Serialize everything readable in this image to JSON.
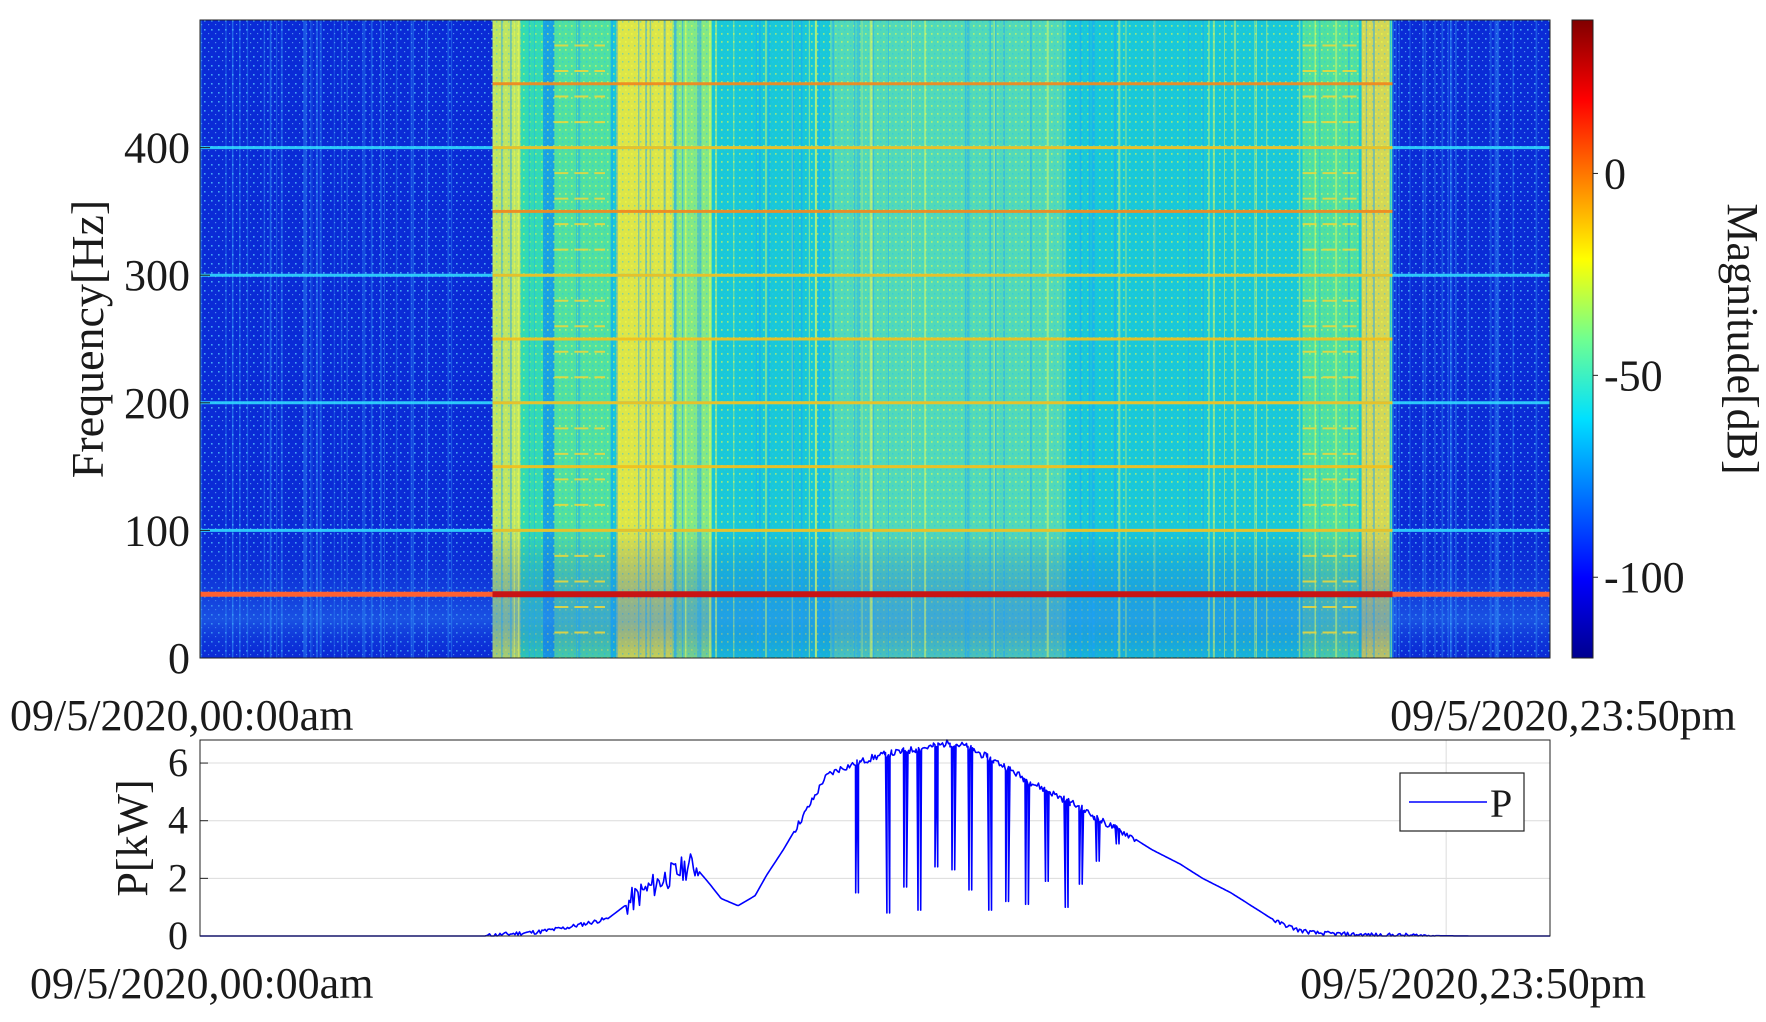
{
  "chart_data": [
    {
      "type": "heatmap",
      "title": "",
      "xlabel": "",
      "ylabel": "Frequency[Hz]",
      "x_start_label": "09/5/2020,00:00am",
      "x_end_label": "09/5/2020,23:50pm",
      "ylim": [
        0,
        500
      ],
      "y_ticks": [
        0,
        100,
        200,
        300,
        400
      ],
      "y_tick_labels": [
        "0",
        "100",
        "200",
        "300",
        "400"
      ],
      "colorbar": {
        "label": "Magnitude[dB]",
        "range": [
          -120,
          38
        ],
        "ticks": [
          0,
          -50,
          -100
        ],
        "tick_labels": [
          "0",
          "-50",
          "-100"
        ],
        "colormap": [
          "#00008f",
          "#0000ff",
          "#0070ff",
          "#00e0ff",
          "#70ff90",
          "#ffff00",
          "#ff8000",
          "#ff0000",
          "#800000"
        ]
      },
      "harmonics_hz": [
        50,
        100,
        150,
        200,
        250,
        300,
        350,
        400,
        450
      ],
      "active_period_hours": [
        5.2,
        21.2
      ],
      "colors": {
        "night_background": "#0a2bd6",
        "day_background": "#19c8d8",
        "fundamental_line": "#c81414",
        "harmonic_line_day": "#f0c020",
        "harmonic_line_night": "#30d8ff"
      }
    },
    {
      "type": "line",
      "title": "",
      "xlabel": "",
      "ylabel": "P[kW]",
      "x_start_label": "09/5/2020,00:00am",
      "x_end_label": "09/5/2020,23:50pm",
      "xlim_hours": [
        0,
        23.8333
      ],
      "ylim": [
        0,
        6.8
      ],
      "y_ticks": [
        0,
        2,
        4,
        6
      ],
      "y_tick_labels": [
        "0",
        "2",
        "4",
        "6"
      ],
      "grid": true,
      "legend_position": "top-right",
      "series": [
        {
          "name": "P",
          "color": "#0000ff",
          "x_hours": [
            0,
            5.0,
            6.0,
            6.5,
            7.2,
            7.8,
            8.2,
            8.7,
            9.0,
            9.2,
            9.5,
            9.8,
            10.0,
            10.3,
            10.6,
            10.9,
            11.0,
            11.1,
            11.3,
            11.6,
            11.9,
            12.1,
            12.4,
            12.7,
            13.0,
            13.2,
            13.5,
            13.8,
            14.2,
            14.6,
            15.1,
            15.5,
            15.9,
            16.4,
            16.8,
            17.3,
            17.7,
            18.2,
            18.6,
            19.0,
            19.4,
            19.7,
            20.0,
            20.4,
            20.8,
            21.2,
            21.8,
            22.5,
            23.8333
          ],
          "values": [
            0.0,
            0.0,
            0.15,
            0.3,
            0.6,
            1.5,
            2.0,
            2.5,
            1.8,
            1.3,
            1.05,
            1.4,
            2.1,
            3.0,
            4.0,
            5.0,
            5.4,
            5.6,
            5.8,
            6.0,
            6.2,
            6.3,
            6.4,
            6.5,
            6.6,
            6.7,
            6.6,
            6.3,
            5.9,
            5.4,
            4.9,
            4.5,
            4.0,
            3.5,
            3.0,
            2.5,
            2.0,
            1.5,
            1.0,
            0.5,
            0.2,
            0.1,
            0.08,
            0.05,
            0.03,
            0.02,
            0.01,
            0.0,
            0.0
          ],
          "dropouts": [
            {
              "hour": 11.6,
              "value": 1.5
            },
            {
              "hour": 12.15,
              "value": 0.8
            },
            {
              "hour": 12.45,
              "value": 1.7
            },
            {
              "hour": 12.7,
              "value": 0.9
            },
            {
              "hour": 13.0,
              "value": 2.4
            },
            {
              "hour": 13.3,
              "value": 2.3
            },
            {
              "hour": 13.6,
              "value": 1.6
            },
            {
              "hour": 13.95,
              "value": 0.9
            },
            {
              "hour": 14.25,
              "value": 1.2
            },
            {
              "hour": 14.6,
              "value": 1.1
            },
            {
              "hour": 14.95,
              "value": 1.9
            },
            {
              "hour": 15.3,
              "value": 1.0
            },
            {
              "hour": 15.55,
              "value": 1.8
            },
            {
              "hour": 15.85,
              "value": 2.6
            },
            {
              "hour": 16.2,
              "value": 3.2
            }
          ]
        }
      ]
    }
  ]
}
